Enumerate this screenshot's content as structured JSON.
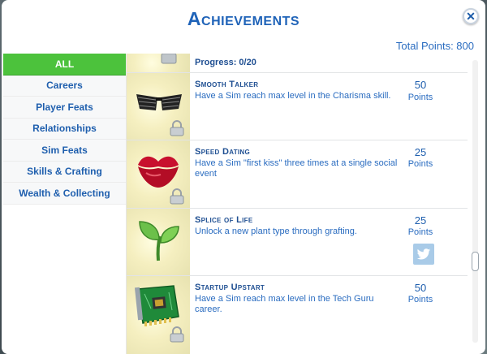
{
  "window": {
    "title": "Achievements",
    "close_icon": "close-icon",
    "total_points": "Total Points: 800"
  },
  "sidebar": {
    "items": [
      {
        "label": "ALL",
        "active": true
      },
      {
        "label": "Careers"
      },
      {
        "label": "Player Feats"
      },
      {
        "label": "Relationships"
      },
      {
        "label": "Sim Feats"
      },
      {
        "label": "Skills & Crafting"
      },
      {
        "label": "Wealth & Collecting"
      }
    ]
  },
  "achievements": [
    {
      "progress": "Progress: 0/20",
      "icon": "padlock-icon"
    },
    {
      "name": "Smooth Talker",
      "description": "Have a Sim reach max level in the Charisma skill.",
      "points": "50",
      "points_label": "Points",
      "icon": "sunglasses-icon"
    },
    {
      "name": "Speed Dating",
      "description": "Have a Sim \"first kiss\" three times at a single social event",
      "points": "25",
      "points_label": "Points",
      "icon": "lips-icon"
    },
    {
      "name": "Splice of Life",
      "description": "Unlock a new plant type through grafting.",
      "points": "25",
      "points_label": "Points",
      "icon": "sprout-icon",
      "share_icon": "twitter-icon"
    },
    {
      "name": "Startup Upstart",
      "description": "Have a Sim reach max level in the Tech Guru career.",
      "points": "50",
      "points_label": "Points",
      "icon": "circuit-board-icon"
    }
  ],
  "colors": {
    "accent_blue": "#1f63b8",
    "active_green": "#4cc23c",
    "thumb_bg": "#f5efc0",
    "twitter_button": "#a9cbe8"
  }
}
